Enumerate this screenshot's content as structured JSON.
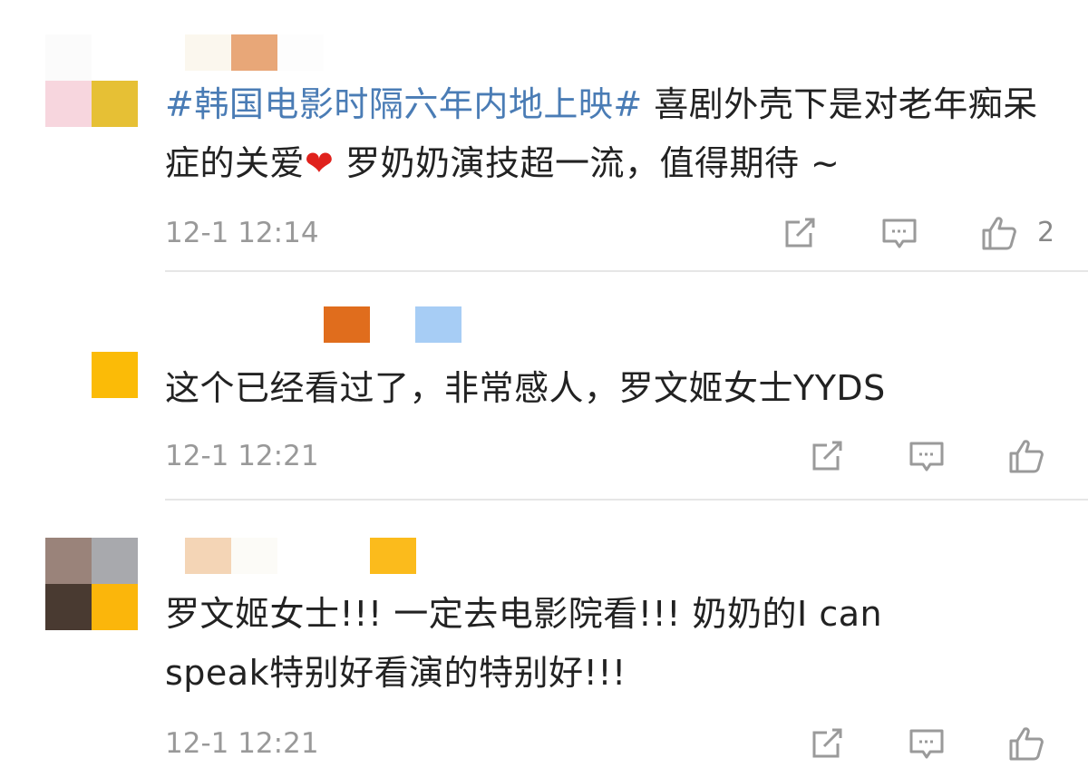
{
  "comments": [
    {
      "avatar_colors": [
        "#fbfbfb",
        "#ffffff",
        "#f7d6de",
        "#e6c035"
      ],
      "name_colors": [
        "#fbf7ee",
        "#e8a778",
        "#fdfdfd"
      ],
      "hashtag": "#韩国电影时隔六年内地上映#",
      "text_part1": " 喜剧外壳下是对老年痴呆症的关爱",
      "heart": "❤",
      "text_part2": " 罗奶奶演技超一流，值得期待 ~",
      "time": "12-1 12:14",
      "likes": "2"
    },
    {
      "avatar_colors": [
        "#ffffff",
        "#ffffff",
        "#ffffff",
        "#fbbb07"
      ],
      "name_colors": [
        "#ffffff",
        "#e06d1d",
        "#a7cdf5"
      ],
      "text": "这个已经看过了，非常感人，罗文姬女士YYDS",
      "time": "12-1 12:21"
    },
    {
      "avatar_colors": [
        "#9a837a",
        "#a8a9ad",
        "#493a31",
        "#fbb60b"
      ],
      "name_colors": [
        "#f4d5b6",
        "#fcfbf7",
        "#fbbb1c"
      ],
      "text_line1": "罗文姬女士!!! 一定去电影院看!!! 奶奶的I can",
      "text_line2": "speak特别好看演的特别好!!!",
      "time": "12-1 12:21"
    }
  ],
  "icons": {
    "repost": "repost-icon",
    "comment": "comment-icon",
    "like": "thumbs-up-icon"
  }
}
